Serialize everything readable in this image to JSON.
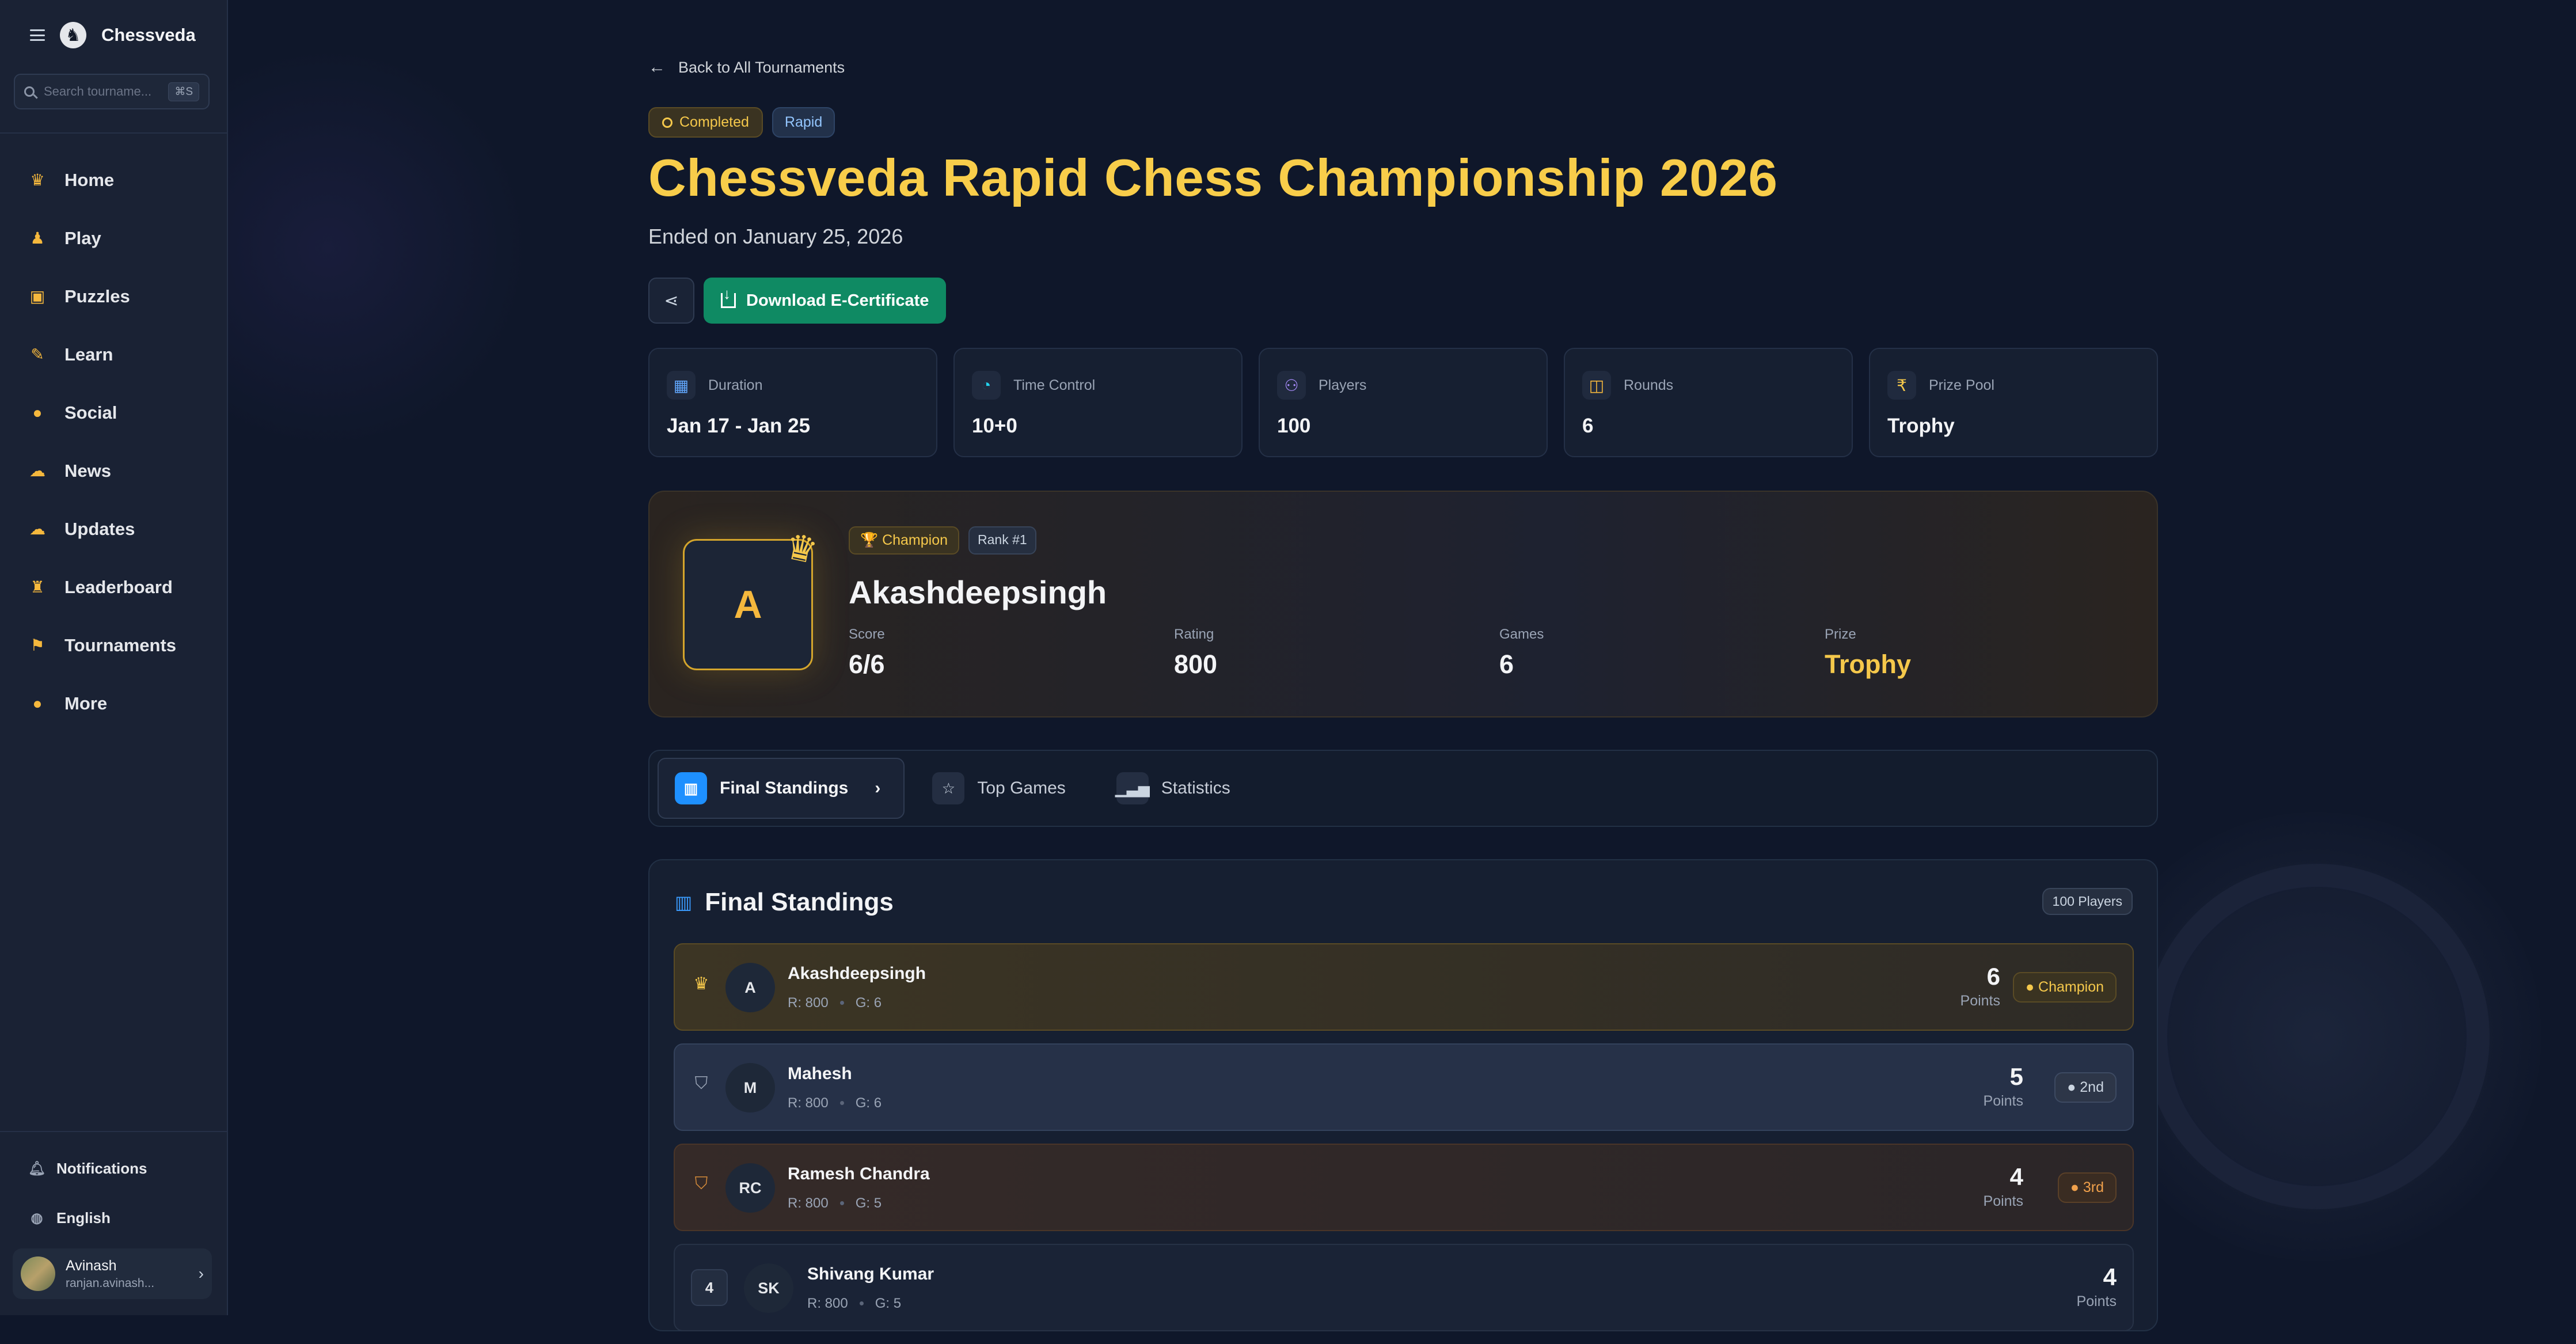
{
  "brand": {
    "name": "Chessveda"
  },
  "search": {
    "placeholder": "Search tourname...",
    "shortcut": "⌘S"
  },
  "nav": [
    {
      "label": "Home",
      "icon": "crown-icon"
    },
    {
      "label": "Play",
      "icon": "play-icon"
    },
    {
      "label": "Puzzles",
      "icon": "puzzle-icon"
    },
    {
      "label": "Learn",
      "icon": "learn-icon"
    },
    {
      "label": "Social",
      "icon": "social-icon"
    },
    {
      "label": "News",
      "icon": "news-icon"
    },
    {
      "label": "Updates",
      "icon": "updates-icon"
    },
    {
      "label": "Leaderboard",
      "icon": "trophy-icon"
    },
    {
      "label": "Tournaments",
      "icon": "tournament-icon"
    },
    {
      "label": "More",
      "icon": "more-icon"
    }
  ],
  "sidebar_bottom": {
    "notifications": "Notifications",
    "language": "English",
    "user": {
      "name": "Avinash",
      "email": "ranjan.avinash..."
    }
  },
  "page": {
    "back": "Back to All Tournaments",
    "status": "Completed",
    "format": "Rapid",
    "title": "Chessveda Rapid Chess Championship 2026",
    "subtitle": "Ended on January 25, 2026",
    "download": "Download E-Certificate"
  },
  "stats": [
    {
      "label": "Duration",
      "value": "Jan 17 - Jan 25",
      "icon": "calendar-icon",
      "color": "#60a5fa"
    },
    {
      "label": "Time Control",
      "value": "10+0",
      "icon": "stopwatch-icon",
      "color": "#22d3ee"
    },
    {
      "label": "Players",
      "value": "100",
      "icon": "users-icon",
      "color": "#a78bfa"
    },
    {
      "label": "Rounds",
      "value": "6",
      "icon": "gamepad-icon",
      "color": "#f5b83d"
    },
    {
      "label": "Prize Pool",
      "value": "Trophy",
      "icon": "rupee-icon",
      "color": "#f5c84b"
    }
  ],
  "champion": {
    "initial": "A",
    "tag": "🏆 Champion",
    "rank": "Rank #1",
    "name": "Akashdeepsingh",
    "score_label": "Score",
    "score": "6/6",
    "rating_label": "Rating",
    "rating": "800",
    "games_label": "Games",
    "games": "6",
    "prize_label": "Prize",
    "prize": "Trophy"
  },
  "tabs": [
    {
      "label": "Final Standings",
      "active": true
    },
    {
      "label": "Top Games",
      "active": false
    },
    {
      "label": "Statistics",
      "active": false
    }
  ],
  "standings": {
    "title": "Final Standings",
    "count": "100 Players",
    "points_label": "Points",
    "rows": [
      {
        "rank": "1",
        "initials": "A",
        "name": "Akashdeepsingh",
        "rating": "R: 800",
        "games": "G: 6",
        "points": "6",
        "place": "Champion",
        "style": "gold"
      },
      {
        "rank": "2",
        "initials": "M",
        "name": "Mahesh",
        "rating": "R: 800",
        "games": "G: 6",
        "points": "5",
        "place": "2nd",
        "style": "silver"
      },
      {
        "rank": "3",
        "initials": "RC",
        "name": "Ramesh Chandra",
        "rating": "R: 800",
        "games": "G: 5",
        "points": "4",
        "place": "3rd",
        "style": "bronze"
      },
      {
        "rank": "4",
        "initials": "SK",
        "name": "Shivang Kumar",
        "rating": "R: 800",
        "games": "G: 5",
        "points": "4",
        "place": "",
        "style": "plain"
      }
    ]
  }
}
